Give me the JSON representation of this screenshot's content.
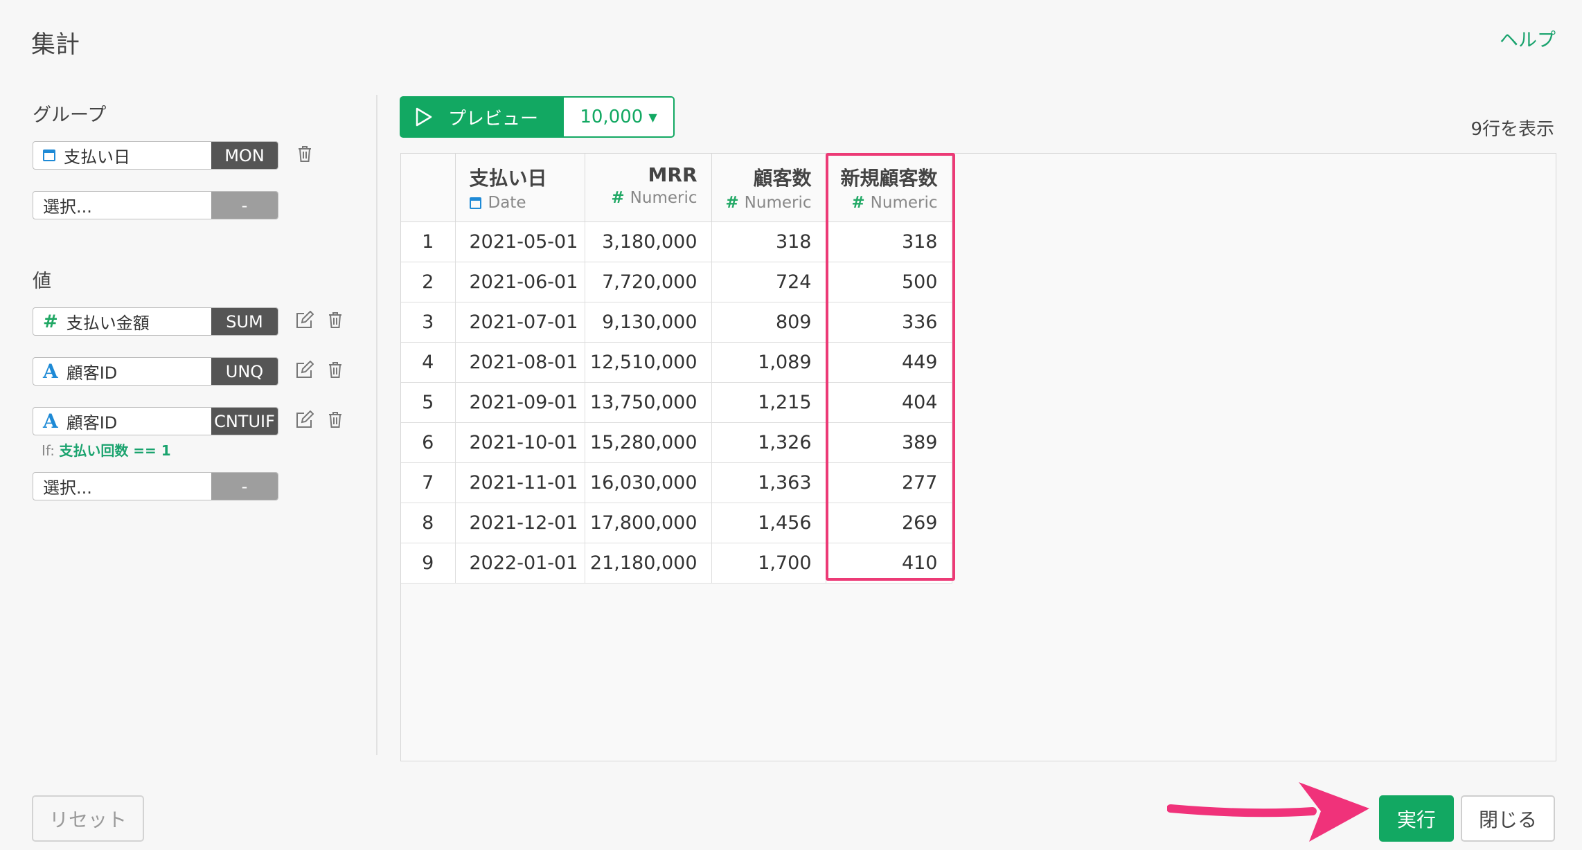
{
  "header": {
    "title": "集計",
    "help": "ヘルプ"
  },
  "group": {
    "label": "グループ",
    "items": [
      {
        "name": "支払い日",
        "tag": "MON",
        "icon": "calendar-icon"
      }
    ],
    "select": {
      "placeholder": "選択...",
      "tag": "-"
    }
  },
  "values": {
    "label": "値",
    "items": [
      {
        "name": "支払い金額",
        "tag": "SUM",
        "icon": "hash-icon"
      },
      {
        "name": "顧客ID",
        "tag": "UNQ",
        "icon": "text-type-icon"
      },
      {
        "name": "顧客ID",
        "tag": "CNTUIF",
        "icon": "text-type-icon"
      }
    ],
    "condition_prefix": "If:",
    "condition_expr": "支払い回数 == 1",
    "select": {
      "placeholder": "選択...",
      "tag": "-"
    }
  },
  "toolbar": {
    "preview": "プレビュー",
    "limit": "10,000",
    "rows_info": "9行を表示"
  },
  "table": {
    "columns": [
      {
        "name": "支払い日",
        "type": "Date"
      },
      {
        "name": "MRR",
        "type": "Numeric"
      },
      {
        "name": "顧客数",
        "type": "Numeric"
      },
      {
        "name": "新規顧客数",
        "type": "Numeric"
      }
    ],
    "rows": [
      [
        "1",
        "2021-05-01",
        "3,180,000",
        "318",
        "318"
      ],
      [
        "2",
        "2021-06-01",
        "7,720,000",
        "724",
        "500"
      ],
      [
        "3",
        "2021-07-01",
        "9,130,000",
        "809",
        "336"
      ],
      [
        "4",
        "2021-08-01",
        "12,510,000",
        "1,089",
        "449"
      ],
      [
        "5",
        "2021-09-01",
        "13,750,000",
        "1,215",
        "404"
      ],
      [
        "6",
        "2021-10-01",
        "15,280,000",
        "1,326",
        "389"
      ],
      [
        "7",
        "2021-11-01",
        "16,030,000",
        "1,363",
        "277"
      ],
      [
        "8",
        "2021-12-01",
        "17,800,000",
        "1,456",
        "269"
      ],
      [
        "9",
        "2022-01-01",
        "21,180,000",
        "1,700",
        "410"
      ]
    ]
  },
  "footer": {
    "reset": "リセット",
    "run": "実行",
    "close": "閉じる"
  },
  "colors": {
    "accent": "#12a862",
    "highlight": "#ec3a76",
    "arrow": "#f0327a",
    "tag": "#555555"
  }
}
